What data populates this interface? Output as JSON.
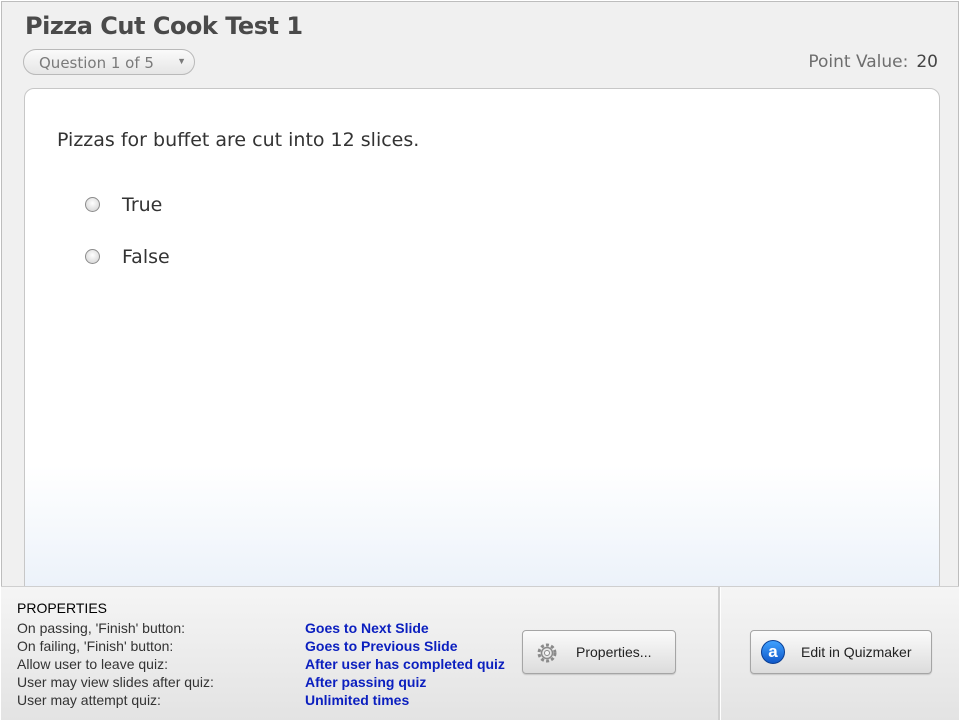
{
  "quiz": {
    "title": "Pizza Cut Cook Test 1",
    "question_selector": "Question 1 of 5",
    "point_value_label": "Point Value:",
    "point_value": "20"
  },
  "question": {
    "text": "Pizzas for buffet are cut into 12 slices.",
    "choices": [
      {
        "label": "True",
        "selected": false
      },
      {
        "label": "False",
        "selected": false
      }
    ]
  },
  "properties": {
    "heading": "PROPERTIES",
    "rows": [
      {
        "key": "On passing, 'Finish' button:",
        "value": "Goes to Next Slide"
      },
      {
        "key": "On failing, 'Finish' button:",
        "value": "Goes to Previous Slide"
      },
      {
        "key": "Allow user to leave quiz:",
        "value": "After user has completed quiz"
      },
      {
        "key": "User may view slides after quiz:",
        "value": "After passing quiz"
      },
      {
        "key": "User may attempt quiz:",
        "value": "Unlimited times"
      }
    ],
    "properties_button": "Properties...",
    "edit_button": "Edit in Quizmaker",
    "edit_icon_letter": "a"
  },
  "colors": {
    "value_text": "#0b1fbf",
    "quizmaker_icon": "#1a6fe0"
  },
  "icons": {
    "properties": "gear-icon",
    "edit": "quizmaker-icon",
    "selector": "chevron-down-icon"
  }
}
